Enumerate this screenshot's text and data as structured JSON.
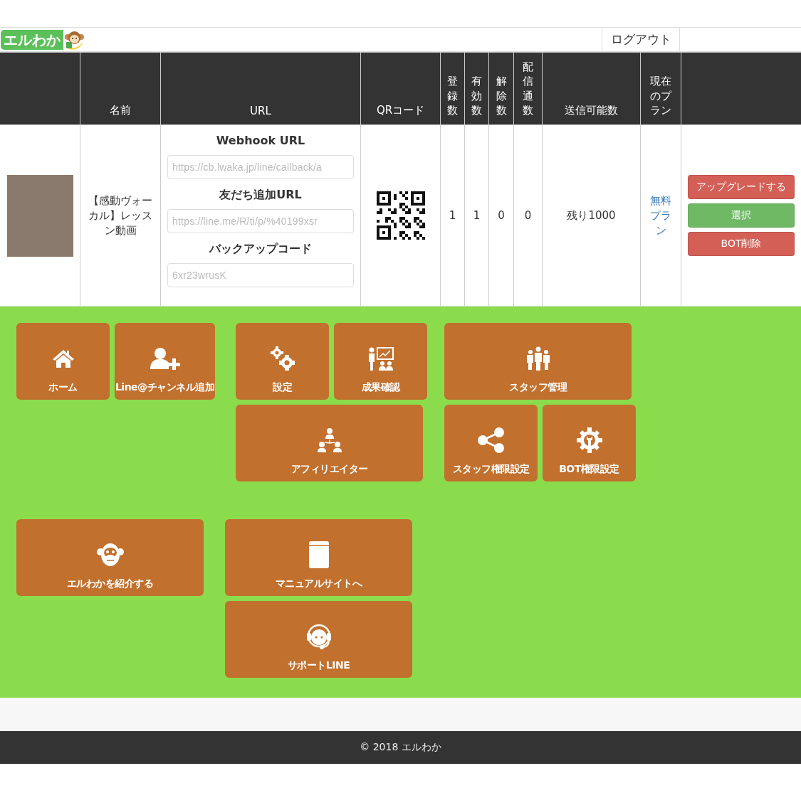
{
  "header": {
    "logo_text": "エルわか",
    "logout": "ログアウト"
  },
  "table": {
    "columns": [
      {
        "label": "名前",
        "vertical": false
      },
      {
        "label": "URL",
        "vertical": false
      },
      {
        "label": "QRコード",
        "vertical": false
      },
      {
        "label": "登録数",
        "vertical": true
      },
      {
        "label": "有効数",
        "vertical": true
      },
      {
        "label": "解除数",
        "vertical": true
      },
      {
        "label": "配信通数",
        "vertical": true
      },
      {
        "label": "送信可能数",
        "vertical": false
      },
      {
        "label": "現在のプラン",
        "vertical": true
      }
    ],
    "rows": [
      {
        "name": "【感動ヴォーカル】レッスン動画",
        "urls": [
          {
            "label": "Webhook URL",
            "value": "https://cb.lwaka.jp/line/callback/a"
          },
          {
            "label": "友だち追加URL",
            "value": "https://line.me/R/ti/p/%40199xsr"
          },
          {
            "label": "バックアップコード",
            "value": "6xr23wrusK"
          }
        ],
        "registered": "1",
        "active": "1",
        "cancelled": "0",
        "delivered": "0",
        "sendable": "残り1000",
        "plan": "無料プラン",
        "buttons": [
          {
            "label": "アップグレードする",
            "kind": "danger"
          },
          {
            "label": "選択",
            "kind": "success"
          },
          {
            "label": "BOT削除",
            "kind": "danger"
          }
        ]
      }
    ]
  },
  "menu": [
    {
      "label": "ホーム"
    },
    {
      "label": "Line@チャンネル追加"
    },
    {
      "label": "設定"
    },
    {
      "label": "成果確認"
    },
    {
      "label": "スタッフ管理"
    },
    {
      "label": "アフィリエイター"
    },
    {
      "label": "スタッフ権限設定"
    },
    {
      "label": "BOT権限設定"
    },
    {
      "label": "エルわかを紹介する"
    },
    {
      "label": "マニュアルサイトへ"
    },
    {
      "label": "サポートLINE"
    }
  ],
  "footer": "© 2018 エルわか"
}
